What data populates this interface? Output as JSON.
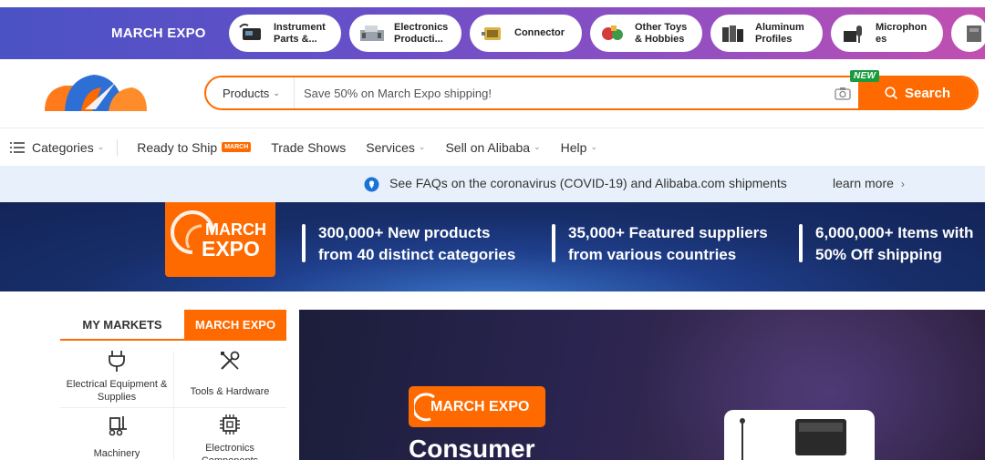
{
  "promo": {
    "title": "MARCH EXPO",
    "pills": [
      {
        "label": "Instrument\nParts &...",
        "icon": "instrument-parts-icon"
      },
      {
        "label": "Electronics\nProducti...",
        "icon": "electronics-production-icon"
      },
      {
        "label": "Connector",
        "icon": "connector-icon"
      },
      {
        "label": "Other Toys\n& Hobbies",
        "icon": "toys-icon"
      },
      {
        "label": "Aluminum\nProfiles",
        "icon": "aluminum-profiles-icon"
      },
      {
        "label": "Microphon\nes",
        "icon": "microphone-icon"
      }
    ]
  },
  "header": {
    "search_category": "Products",
    "search_placeholder": "Save 50% on March Expo shipping!",
    "search_button": "Search",
    "new_badge": "NEW"
  },
  "nav": {
    "categories": "Categories",
    "ready_to_ship": "Ready to Ship",
    "ready_badge": "MARCH",
    "trade_shows": "Trade Shows",
    "services": "Services",
    "sell": "Sell on Alibaba",
    "help": "Help"
  },
  "notice": {
    "text": "See FAQs on the coronavirus (COVID-19) and Alibaba.com shipments",
    "link": "learn more"
  },
  "banner": {
    "badge_line1": "MARCH",
    "badge_line2": "EXPO",
    "stats": [
      {
        "line1": "300,000+ New products",
        "line2": "from 40 distinct categories"
      },
      {
        "line1": "35,000+ Featured suppliers",
        "line2": "from various countries"
      },
      {
        "line1": "6,000,000+ Items with",
        "line2": "50% Off shipping"
      }
    ]
  },
  "sidebar": {
    "tab_my": "MY MARKETS",
    "tab_expo": "MARCH EXPO",
    "categories": [
      {
        "label": "Electrical Equipment & Supplies"
      },
      {
        "label": "Tools & Hardware"
      },
      {
        "label": "Machinery"
      },
      {
        "label": "Electronics Components"
      }
    ]
  },
  "hero": {
    "badge": "MARCH EXPO",
    "title": "Consumer"
  },
  "colors": {
    "accent": "#ff6a00",
    "promo_start": "#4a52c4",
    "promo_end": "#c24fb0",
    "notice_bg": "#e8f1fb",
    "banner_bg": "#172e6a"
  }
}
